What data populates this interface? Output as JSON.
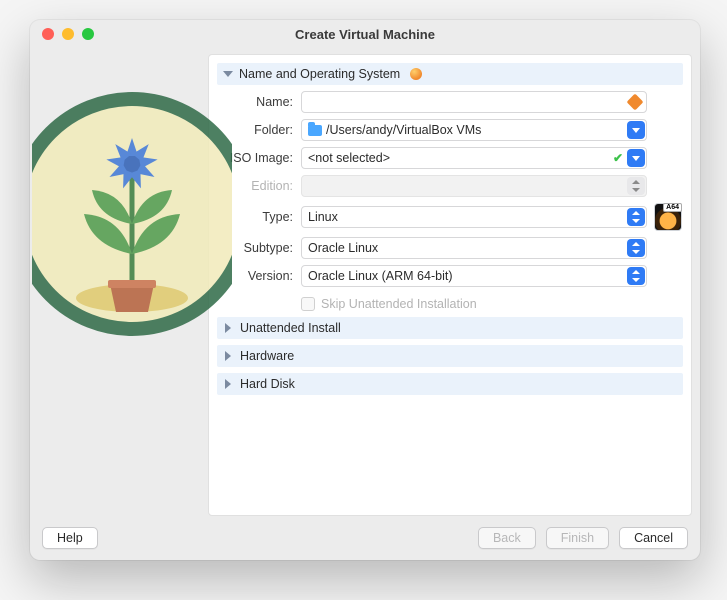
{
  "window": {
    "title": "Create Virtual Machine"
  },
  "sections": {
    "name_os": {
      "title": "Name and Operating System"
    },
    "unattended": {
      "title": "Unattended Install"
    },
    "hardware": {
      "title": "Hardware"
    },
    "harddisk": {
      "title": "Hard Disk"
    }
  },
  "labels": {
    "name": "Name:",
    "folder": "Folder:",
    "iso": "ISO Image:",
    "edition": "Edition:",
    "type": "Type:",
    "subtype": "Subtype:",
    "version": "Version:",
    "skip": "Skip Unattended Installation"
  },
  "values": {
    "name": "",
    "folder": "/Users/andy/VirtualBox VMs",
    "iso": "<not selected>",
    "edition": "",
    "type": "Linux",
    "subtype": "Oracle Linux",
    "version": "Oracle Linux (ARM 64-bit)"
  },
  "footer": {
    "help": "Help",
    "back": "Back",
    "finish": "Finish",
    "cancel": "Cancel"
  }
}
